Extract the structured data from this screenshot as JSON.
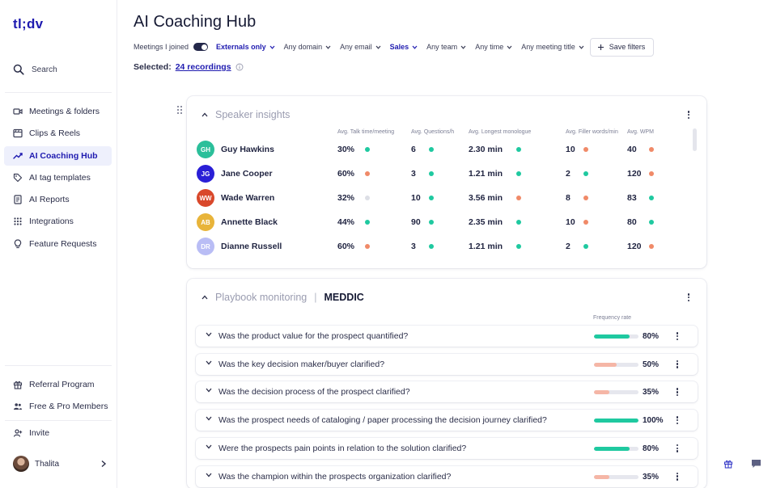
{
  "app": {
    "logo": "tl;dv"
  },
  "sidebar": {
    "search_label": "Search",
    "items": [
      {
        "label": "Meetings & folders",
        "icon": "video-icon"
      },
      {
        "label": "Clips & Reels",
        "icon": "film-icon"
      },
      {
        "label": "AI Coaching Hub",
        "icon": "trend-icon",
        "active": true
      },
      {
        "label": "AI tag templates",
        "icon": "tag-icon"
      },
      {
        "label": "AI Reports",
        "icon": "report-icon"
      },
      {
        "label": "Integrations",
        "icon": "grid-icon"
      },
      {
        "label": "Feature Requests",
        "icon": "bulb-icon"
      }
    ],
    "bottom_items": [
      {
        "label": "Referral Program",
        "icon": "gift-icon"
      },
      {
        "label": "Free & Pro Members",
        "icon": "users-icon"
      }
    ],
    "invite_label": "Invite",
    "user_name": "Thalita"
  },
  "header": {
    "title": "AI Coaching Hub",
    "toggle_label": "Meetings I joined",
    "filters": [
      {
        "label": "Externals only",
        "bold": true
      },
      {
        "label": "Any domain",
        "bold": false
      },
      {
        "label": "Any email",
        "bold": false
      },
      {
        "label": "Sales",
        "bold": true
      },
      {
        "label": "Any team",
        "bold": false
      },
      {
        "label": "Any time",
        "bold": false
      },
      {
        "label": "Any meeting title",
        "bold": false
      }
    ],
    "save_filters_label": "Save filters",
    "selected_label": "Selected:",
    "selected_link": "24 recordings"
  },
  "speaker_insights": {
    "title": "Speaker insights",
    "columns": [
      "Avg. Talk time/meeting",
      "Avg. Questions/h",
      "Avg. Longest monologue",
      "Avg. Filler words/min",
      "Avg. WPM"
    ],
    "rows": [
      {
        "initials": "GH",
        "name": "Guy Hawkins",
        "color": "#2bbf9a",
        "values": [
          "30%",
          "6",
          "2.30 min",
          "10",
          "40"
        ],
        "status": [
          "good",
          "good",
          "good",
          "warn",
          "warn"
        ]
      },
      {
        "initials": "JG",
        "name": "Jane Cooper",
        "color": "#2a1fd6",
        "values": [
          "60%",
          "3",
          "1.21 min",
          "2",
          "120"
        ],
        "status": [
          "warn",
          "good",
          "good",
          "good",
          "warn"
        ]
      },
      {
        "initials": "WW",
        "name": "Wade Warren",
        "color": "#d9482b",
        "values": [
          "32%",
          "10",
          "3.56 min",
          "8",
          "83"
        ],
        "status": [
          "neutral",
          "good",
          "warn",
          "warn",
          "good"
        ]
      },
      {
        "initials": "AB",
        "name": "Annette Black",
        "color": "#e8b43a",
        "values": [
          "44%",
          "90",
          "2.35 min",
          "10",
          "80"
        ],
        "status": [
          "good",
          "good",
          "good",
          "warn",
          "good"
        ]
      },
      {
        "initials": "DR",
        "name": "Dianne Russell",
        "color": "#b9bdf5",
        "values": [
          "60%",
          "3",
          "1.21 min",
          "2",
          "120"
        ],
        "status": [
          "warn",
          "good",
          "good",
          "good",
          "warn"
        ]
      }
    ]
  },
  "playbook": {
    "title": "Playbook monitoring",
    "framework": "MEDDIC",
    "frequency_label": "Frequency rate",
    "questions": [
      {
        "text": "Was the product value for the prospect quantified?",
        "rate": 80,
        "label": "80%",
        "color": "#1fc9a0"
      },
      {
        "text": "Was the key decision maker/buyer clarified?",
        "rate": 50,
        "label": "50%",
        "color": "#f5b6a6"
      },
      {
        "text": "Was the decision process of the prospect clarified?",
        "rate": 35,
        "label": "35%",
        "color": "#f5b6a6"
      },
      {
        "text": "Was the prospect needs of cataloging / paper processing the decision journey clarified?",
        "rate": 100,
        "label": "100%",
        "color": "#1fc9a0"
      },
      {
        "text": "Were the prospects pain points in relation to the solution clarified?",
        "rate": 80,
        "label": "80%",
        "color": "#1fc9a0"
      },
      {
        "text": "Was the champion within the prospects organization clarified?",
        "rate": 35,
        "label": "35%",
        "color": "#f5b6a6"
      }
    ]
  },
  "status_colors": {
    "good": "#1fc9a0",
    "warn": "#f08a68",
    "neutral": "#dddfe6"
  }
}
